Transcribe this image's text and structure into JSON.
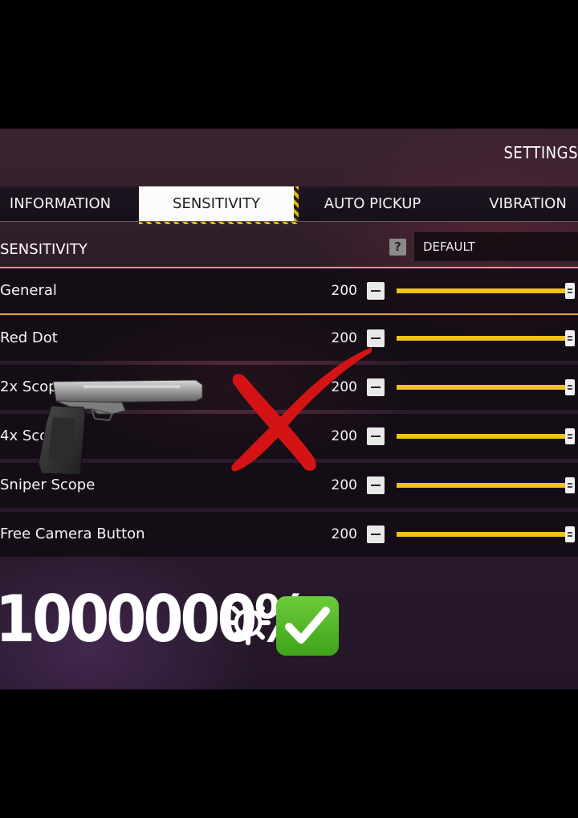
{
  "header": {
    "title": "SETTINGS"
  },
  "tabs": [
    {
      "label": "INFORMATION"
    },
    {
      "label": "SENSITIVITY"
    },
    {
      "label": "AUTO PICKUP"
    },
    {
      "label": "VIBRATION"
    }
  ],
  "section": {
    "label": "SENSITIVITY",
    "help_icon": "?",
    "preset": "DEFAULT"
  },
  "rows": [
    {
      "label": "General",
      "value": "200",
      "level": 1.0
    },
    {
      "label": "Red Dot",
      "value": "200",
      "level": 1.0
    },
    {
      "label": "2x Scope",
      "value": "200",
      "level": 1.0
    },
    {
      "label": "4x Scope",
      "value": "200",
      "level": 1.0
    },
    {
      "label": "Sniper Scope",
      "value": "200",
      "level": 1.0
    },
    {
      "label": "Free Camera Button",
      "value": "200",
      "level": 1.0
    }
  ],
  "overlay": {
    "big_text": "1000000%",
    "gear_icon": "gear-emoji",
    "check_icon": "check-mark-button-emoji",
    "x_mark": "red-x-mark",
    "gun": "pistol-image"
  },
  "colors": {
    "slider_fill": "#f2c21b",
    "accent_border": "#e0a23a",
    "x_red": "#d41414"
  }
}
